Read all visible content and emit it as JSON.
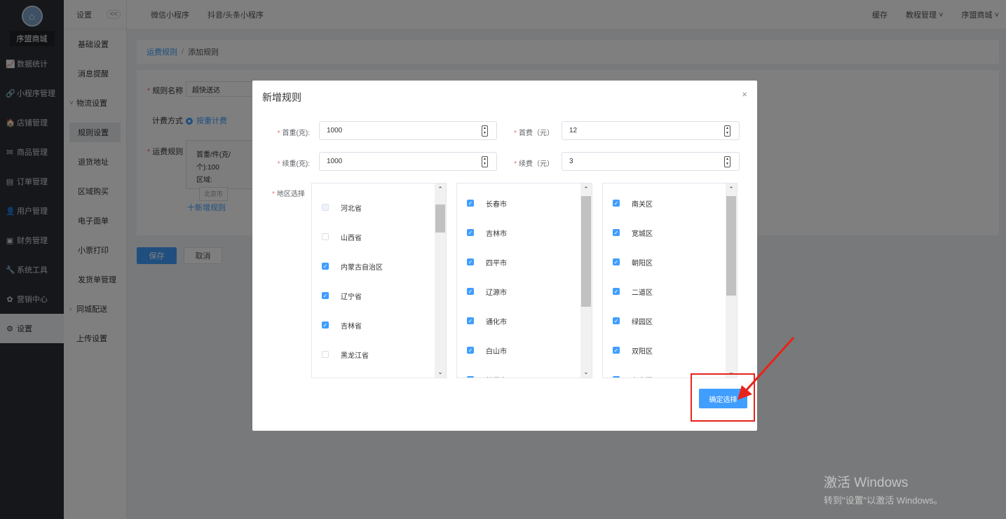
{
  "sidebar": {
    "shop_name": "序盟商城",
    "items": [
      {
        "icon": "chart-icon",
        "glyph": "📈",
        "label": "数据统计"
      },
      {
        "icon": "link-icon",
        "glyph": "🔗",
        "label": "小程序管理"
      },
      {
        "icon": "store-icon",
        "glyph": "🏠",
        "label": "店铺管理"
      },
      {
        "icon": "mail-icon",
        "glyph": "✉",
        "label": "商品管理"
      },
      {
        "icon": "list-icon",
        "glyph": "▤",
        "label": "订单管理"
      },
      {
        "icon": "user-icon",
        "glyph": "👤",
        "label": "用户管理"
      },
      {
        "icon": "wallet-icon",
        "glyph": "▣",
        "label": "财务管理"
      },
      {
        "icon": "wrench-icon",
        "glyph": "🔧",
        "label": "系统工具"
      },
      {
        "icon": "marketing-icon",
        "glyph": "✿",
        "label": "营销中心"
      },
      {
        "icon": "gear-icon",
        "glyph": "⚙",
        "label": "设置"
      }
    ]
  },
  "submenu": {
    "title": "设置",
    "collapse": "<<",
    "items": [
      "基础设置",
      "消息提醒",
      "物流设置",
      "规则设置",
      "退货地址",
      "区域购买",
      "电子面单",
      "小票打印",
      "发货单管理",
      "同城配送",
      "上传设置"
    ]
  },
  "topbar": {
    "tabs": [
      "微信小程序",
      "抖音/头条小程序"
    ],
    "right": [
      "缓存",
      "教程管理 ˅",
      "序盟商城 ˅"
    ]
  },
  "breadcrumb": {
    "link": "运费规则",
    "sep": "/",
    "current": "添加规则"
  },
  "form": {
    "name_label": "规则名称",
    "name_value": "超快送达",
    "billing_label": "计费方式",
    "billing_value": "按重计费",
    "rule_label": "运费规则",
    "rule_line1": "首重/件(克/个):100",
    "rule_line2": "区域:",
    "rule_region": "北京市",
    "add_rule": "十新增规则",
    "save": "保存",
    "cancel": "取消"
  },
  "dialog": {
    "title": "新增规则",
    "close": "×",
    "first_weight_label": "首重(克):",
    "first_weight_value": "1000",
    "first_fee_label": "首费（元）",
    "first_fee_value": "12",
    "cont_weight_label": "续重(克):",
    "cont_weight_value": "1000",
    "cont_fee_label": "续费（元）",
    "cont_fee_value": "3",
    "region_label": "地区选择",
    "provinces": [
      {
        "label": "河北省",
        "state": "disabled"
      },
      {
        "label": "山西省",
        "state": "off"
      },
      {
        "label": "内蒙古自治区",
        "state": "on"
      },
      {
        "label": "辽宁省",
        "state": "on"
      },
      {
        "label": "吉林省",
        "state": "on"
      },
      {
        "label": "黑龙江省",
        "state": "off"
      }
    ],
    "cities": [
      {
        "label": "长春市",
        "state": "on"
      },
      {
        "label": "吉林市",
        "state": "on"
      },
      {
        "label": "四平市",
        "state": "on"
      },
      {
        "label": "辽源市",
        "state": "on"
      },
      {
        "label": "通化市",
        "state": "on"
      },
      {
        "label": "白山市",
        "state": "on"
      },
      {
        "label": "松原市",
        "state": "on"
      }
    ],
    "districts": [
      {
        "label": "南关区",
        "state": "on"
      },
      {
        "label": "宽城区",
        "state": "on"
      },
      {
        "label": "朝阳区",
        "state": "on"
      },
      {
        "label": "二道区",
        "state": "on"
      },
      {
        "label": "绿园区",
        "state": "on"
      },
      {
        "label": "双阳区",
        "state": "on"
      },
      {
        "label": "九台区",
        "state": "on"
      }
    ],
    "confirm": "确定选择"
  },
  "watermark": {
    "line1": "激活 Windows",
    "line2": "转到\"设置\"以激活 Windows。"
  },
  "colors": {
    "primary": "#409eff",
    "highlight": "#e8231b",
    "sidebar": "#2b2f36"
  }
}
